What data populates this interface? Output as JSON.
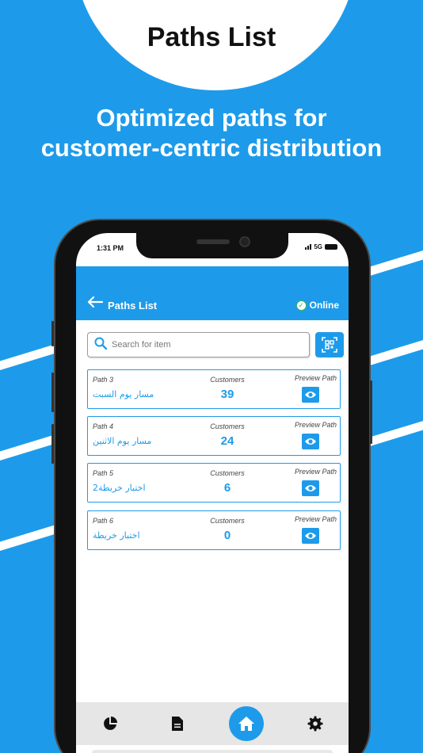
{
  "hero": {
    "title": "Paths List",
    "tagline_line1": "Optimized paths for",
    "tagline_line2": "customer-centric distribution"
  },
  "status_bar": {
    "time": "1:31 PM",
    "network": "5G"
  },
  "app_bar": {
    "back_icon": "arrow-left-icon",
    "title": "Paths List",
    "status_label": "Online",
    "status_icon": "check-circle-icon",
    "status_color": "#2fbf4a"
  },
  "search": {
    "placeholder": "Search for item",
    "icon": "search-icon",
    "qr_button_icon": "qr-scan-icon"
  },
  "path_cards": [
    {
      "path_label": "Path 3",
      "name": "مسار يوم السبت",
      "customers_label": "Customers",
      "customers": "39",
      "preview_label": "Preview Path"
    },
    {
      "path_label": "Path 4",
      "name": "مسار يوم الاثنين",
      "customers_label": "Customers",
      "customers": "24",
      "preview_label": "Preview Path"
    },
    {
      "path_label": "Path 5",
      "name": "اختبار خريطة2",
      "customers_label": "Customers",
      "customers": "6",
      "preview_label": "Preview Path"
    },
    {
      "path_label": "Path 6",
      "name": "اختبار خريطة",
      "customers_label": "Customers",
      "customers": "0",
      "preview_label": "Preview Path"
    }
  ],
  "bottom_nav": {
    "items": [
      "pie-chart-icon",
      "document-icon",
      "home-icon",
      "settings-gear-icon"
    ],
    "active": "home-icon"
  },
  "colors": {
    "accent": "#1d9bea",
    "background": "#1d9bea",
    "nav_bg": "#e6e6e6"
  }
}
